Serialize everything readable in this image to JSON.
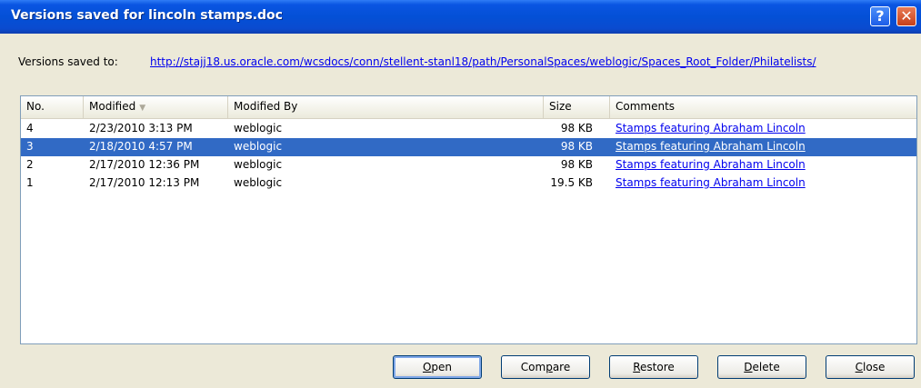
{
  "window": {
    "title": "Versions saved for lincoln stamps.doc"
  },
  "titlebar": {
    "help_glyph": "?",
    "close_glyph": "✕"
  },
  "saved_to": {
    "label": "Versions saved to:",
    "path": "http://stajj18.us.oracle.com/wcsdocs/conn/stellent-stanl18/path/PersonalSpaces/weblogic/Spaces_Root_Folder/Philatelists/"
  },
  "list": {
    "columns": [
      "No.",
      "Modified",
      "Modified By",
      "Size",
      "Comments"
    ],
    "sort_indicator": "▼",
    "rows": [
      {
        "no": "4",
        "modified": "2/23/2010 3:13 PM",
        "by": "weblogic",
        "size": "98 KB",
        "comment": "Stamps featuring Abraham Lincoln"
      },
      {
        "no": "3",
        "modified": "2/18/2010 4:57 PM",
        "by": "weblogic",
        "size": "98 KB",
        "comment": "Stamps featuring Abraham Lincoln"
      },
      {
        "no": "2",
        "modified": "2/17/2010 12:36 PM",
        "by": "weblogic",
        "size": "98 KB",
        "comment": "Stamps featuring Abraham Lincoln"
      },
      {
        "no": "1",
        "modified": "2/17/2010 12:13 PM",
        "by": "weblogic",
        "size": "19.5 KB",
        "comment": "Stamps featuring Abraham Lincoln"
      }
    ]
  },
  "buttons": {
    "open": {
      "mnemonic": "O",
      "rest": "pen"
    },
    "compare": {
      "pre": "Com",
      "mnemonic": "p",
      "rest": "are"
    },
    "restore": {
      "mnemonic": "R",
      "rest": "estore"
    },
    "delete": {
      "mnemonic": "D",
      "rest": "elete"
    },
    "close": {
      "mnemonic": "C",
      "rest": "lose"
    }
  },
  "colors": {
    "title_blue": "#0450d6",
    "selection": "#316ac5",
    "link": "#0000ee",
    "face": "#ece9d8"
  }
}
